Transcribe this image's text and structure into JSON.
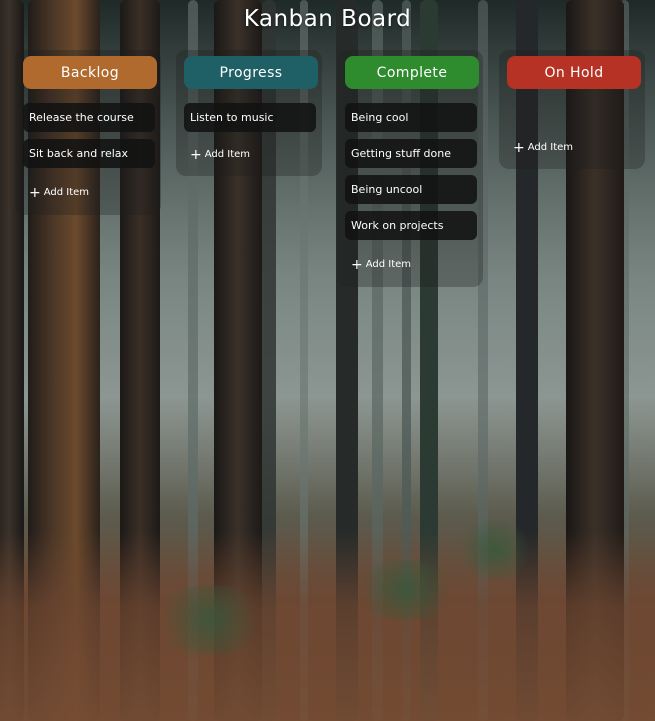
{
  "title": "Kanban Board",
  "colors": {
    "backlog": "#b06a2e",
    "progress": "#1f5f66",
    "complete": "#2e8b2e",
    "on_hold": "#b53225"
  },
  "columns": [
    {
      "key": "backlog",
      "label": "Backlog",
      "items": [
        "Release the course",
        "Sit back and relax"
      ],
      "add_label": "Add Item",
      "add_icon": "plus-icon"
    },
    {
      "key": "progress",
      "label": "Progress",
      "items": [
        "Listen to music"
      ],
      "add_label": "Add Item",
      "add_icon": "plus-icon"
    },
    {
      "key": "complete",
      "label": "Complete",
      "items": [
        "Being cool",
        "Getting stuff done",
        "Being uncool",
        "Work on projects"
      ],
      "add_label": "Add Item",
      "add_icon": "plus-icon"
    },
    {
      "key": "on_hold",
      "label": "On Hold",
      "items": [],
      "add_label": "Add Item",
      "add_icon": "plus-icon"
    }
  ]
}
